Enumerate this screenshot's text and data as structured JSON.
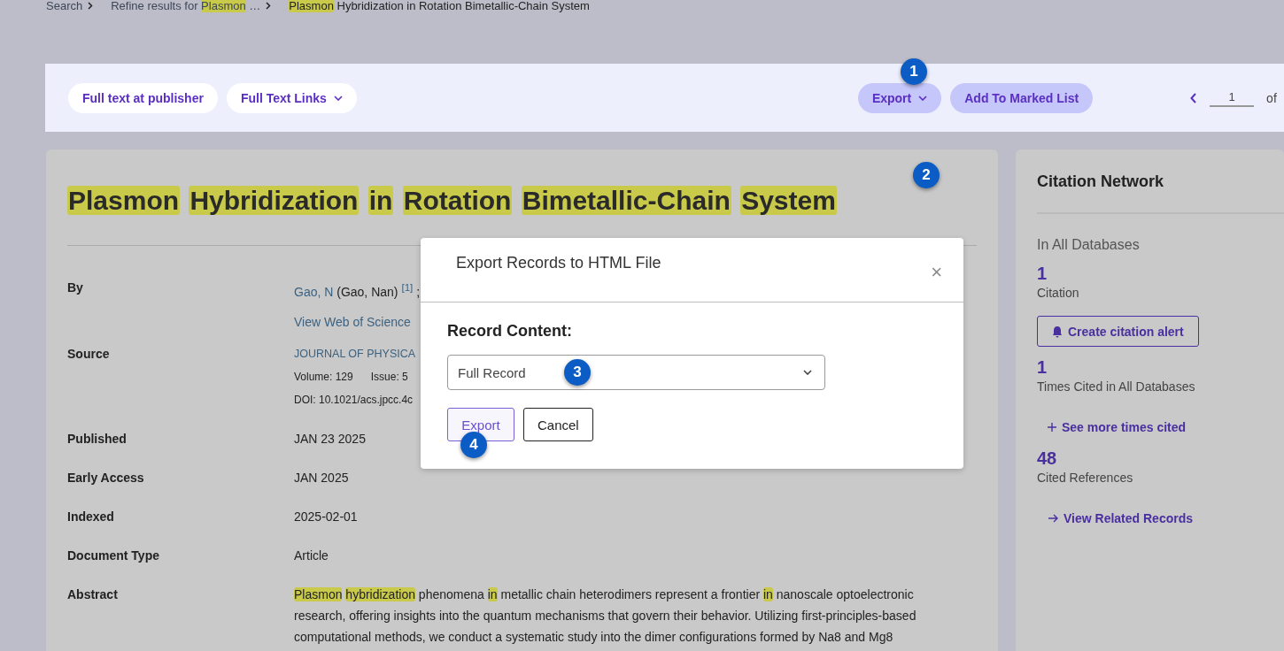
{
  "breadcrumb": [
    {
      "segments": [
        {
          "text": "Search",
          "highlighted": false
        }
      ]
    },
    {
      "segments": [
        {
          "text": "Refine results for",
          "highlighted": false
        },
        {
          "text": "Plasmon",
          "highlighted": true
        },
        {
          "text": "…",
          "highlighted": false
        }
      ]
    },
    {
      "segments": [
        {
          "text": "Plasmon",
          "highlighted": true
        },
        {
          "text": "Hybridization in Rotation Bimetallic-Chain System",
          "highlighted": false
        }
      ]
    }
  ],
  "toolbar": {
    "left_buttons": [
      {
        "label": "Full text at publisher",
        "dropdown": false
      },
      {
        "label": "Full Text Links",
        "dropdown": true
      }
    ],
    "right_buttons": [
      {
        "label": "Export",
        "dropdown": true
      },
      {
        "label": "Add To Marked List",
        "dropdown": false
      }
    ],
    "pager": {
      "value": "1",
      "of": "of"
    }
  },
  "record": {
    "title": [
      {
        "text": "Plasmon",
        "highlighted": true
      },
      {
        "text": "Hybridization",
        "highlighted": true
      },
      {
        "text": "in",
        "highlighted": true
      },
      {
        "text": "Rotation",
        "highlighted": true
      },
      {
        "text": "Bimetallic-Chain",
        "highlighted": true
      },
      {
        "text": "System",
        "highlighted": true
      }
    ],
    "by": {
      "label": "By",
      "author_link": "Gao, N",
      "author_name": "(Gao, Nan)",
      "affiliation": "[1]",
      "separator": ";",
      "researcher_link": "View Web of Science"
    },
    "source": {
      "label": "Source",
      "journal": "JOURNAL OF PHYSICA",
      "volume": "Volume: 129",
      "issue": "Issue: 5",
      "doi": "DOI: 10.1021/acs.jpcc.4c"
    },
    "fields": [
      {
        "label": "Published",
        "value": "JAN 23 2025"
      },
      {
        "label": "Early Access",
        "value": "JAN 2025"
      },
      {
        "label": "Indexed",
        "value": "2025-02-01"
      },
      {
        "label": "Document Type",
        "value": "Article"
      }
    ],
    "abstract": {
      "label": "Abstract",
      "segments": [
        {
          "text": "Plasmon",
          "highlighted": true
        },
        {
          "text": "hybridization",
          "highlighted": true
        },
        {
          "text": "phenomena",
          "highlighted": false
        },
        {
          "text": "in",
          "highlighted": true
        },
        {
          "text": "metallic chain heterodimers represent a frontier",
          "highlighted": false
        },
        {
          "text": "in",
          "highlighted": true
        },
        {
          "text": "nanoscale optoelectronic research, offering insights into the quantum mechanisms that govern their behavior. Utilizing first-principles-based computational methods, we conduct a systematic study into the dimer configurations formed by Na8 and Mg8",
          "highlighted": false
        }
      ]
    }
  },
  "citation_network": {
    "title": "Citation Network",
    "subtitle": "In All Databases",
    "items": [
      {
        "kind": "count",
        "number": "1",
        "label": "Citation"
      },
      {
        "kind": "alert",
        "label": "Create citation alert"
      },
      {
        "kind": "count",
        "number": "1",
        "label": "Times Cited in All Databases"
      },
      {
        "kind": "more",
        "label": "See more times cited"
      },
      {
        "kind": "count",
        "number": "48",
        "label": "Cited References"
      },
      {
        "kind": "related",
        "label": "View Related Records"
      }
    ]
  },
  "dialog": {
    "title": "Export Records to HTML File",
    "close": "×",
    "field_label": "Record Content:",
    "select_value": "Full Record",
    "buttons": [
      {
        "label": "Export",
        "kind": "primary"
      },
      {
        "label": "Cancel",
        "kind": "secondary"
      }
    ]
  },
  "step_markers": [
    {
      "number": "1"
    },
    {
      "number": "2"
    },
    {
      "number": "3"
    },
    {
      "number": "4"
    }
  ]
}
